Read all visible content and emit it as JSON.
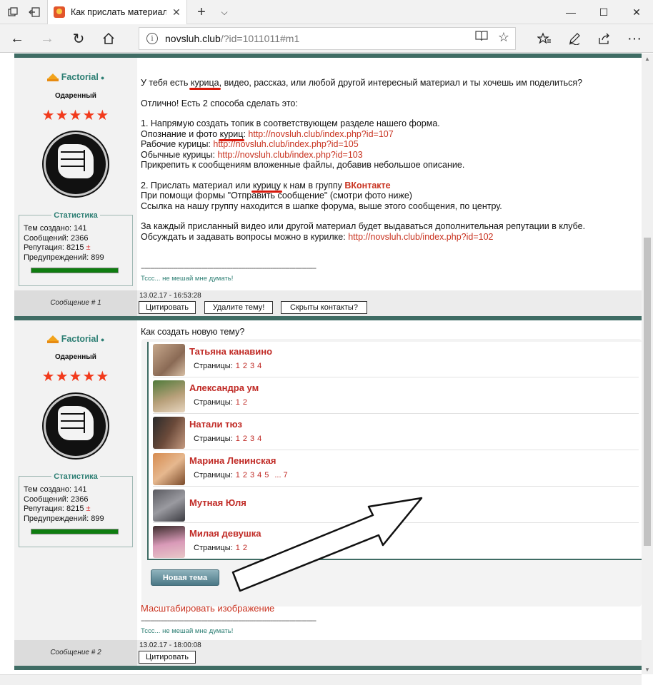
{
  "browser": {
    "tab_title": "Как прислать материал",
    "url_host": "novsluh.club",
    "url_rest": "/?id=1011011#m1"
  },
  "posts": [
    {
      "author": "Factorial",
      "rank": "Одаренный",
      "stars": "★★★★★",
      "stats": {
        "title": "Статистика",
        "topics": "Тем создано: 141",
        "messages": "Сообщений: 2366",
        "reputation": "Репутация: 8215",
        "rep_sign": "±",
        "warnings": "Предупреждений: 899"
      },
      "footer_label": "Сообщение # 1",
      "date": "13.02.17 - 16:53:28",
      "buttons": [
        "Цитировать",
        "Удалите тему!",
        "Скрыты контакты?"
      ]
    },
    {
      "author": "Factorial",
      "rank": "Одаренный",
      "stars": "★★★★★",
      "stats": {
        "title": "Статистика",
        "topics": "Тем создано: 141",
        "messages": "Сообщений: 2366",
        "reputation": "Репутация: 8215",
        "rep_sign": "±",
        "warnings": "Предупреждений: 899"
      },
      "footer_label": "Сообщение # 2",
      "date": "13.02.17 - 18:00:08",
      "buttons": [
        "Цитировать"
      ]
    }
  ],
  "post1": {
    "line1_a": "У тебя есть ",
    "line1_kur": "курица",
    "line1_b": ", видео, рассказ, или любой другой интересный материал и ты хочешь им поделиться?",
    "line2": "Отлично! Есть 2 способа сделать это:",
    "line3": "1. Напрямую создать топик в соответствующем разделе нашего форма.",
    "line4_a": "Опознание и фото ",
    "line4_kur": "куриц",
    "line4_b": ": ",
    "line4_link": "http://novsluh.club/index.php?id=107",
    "line5_a": "Рабочие курицы: ",
    "line5_link": "http://novsluh.club/index.php?id=105",
    "line6_a": "Обычные курицы: ",
    "line6_link": "http://novsluh.club/index.php?id=103",
    "line7": "Прикрепить к сообщениям вложенные файлы, добавив небольшое описание.",
    "line8_a": "2. Прислать материал или ",
    "line8_kur": "курицу",
    "line8_b": " к нам в группу ",
    "line8_vk": "ВКонтакте",
    "line9": "При помощи формы \"Отправить сообщение\" (смотри фото ниже)",
    "line10": "Ссылка на нашу группу находится в шапке форума, выше этого сообщения, по центру.",
    "line11": "За каждый присланный видео или другой материал будет выдаваться дополнительная репутации в клубе.",
    "line12_a": "Обсуждать и задавать вопросы можно в курилке: ",
    "line12_link": "http://novsluh.club/index.php?id=102",
    "dashes": "--------------------------------------------------------------------------------------------",
    "signature": "Тссс... не мешай мне думать!"
  },
  "post2": {
    "question": "Как создать новую тему?",
    "pages_label": "Страницы:",
    "friends": [
      {
        "name": "Татьяна канавино",
        "pages": [
          "1",
          "2",
          "3",
          "4"
        ]
      },
      {
        "name": "Александра ум",
        "pages": [
          "1",
          "2"
        ]
      },
      {
        "name": "Натали тюз",
        "pages": [
          "1",
          "2",
          "3",
          "4"
        ]
      },
      {
        "name": "Марина Ленинская",
        "pages": [
          "1",
          "2",
          "3",
          "4",
          "5",
          "... 7"
        ]
      },
      {
        "name": "Мутная Юля",
        "pages": []
      },
      {
        "name": "Милая девушка",
        "pages": [
          "1",
          "2"
        ]
      }
    ],
    "new_topic": "Новая тема",
    "scale": "Масштабировать изображение",
    "dashes": "--------------------------------------------------------------------------------------------",
    "signature": "Тссс... не мешай мне думать!"
  },
  "colors": {
    "teal": "#3f6c64",
    "link_red": "#c8321f",
    "name_teal": "#2c7e73"
  }
}
